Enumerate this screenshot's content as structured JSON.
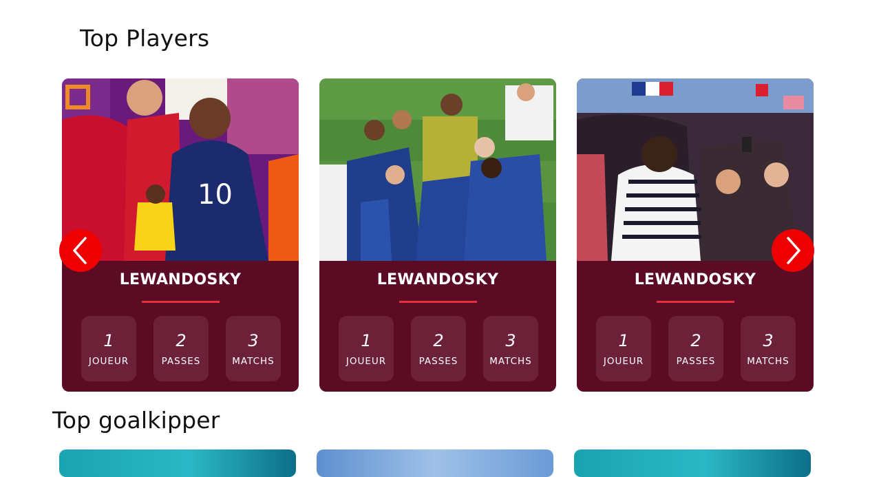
{
  "sections": {
    "top_players_title": "Top Players",
    "top_goalkeeper_title": "Top goalkipper"
  },
  "players": [
    {
      "name": "LEWANDOSKY",
      "stats": [
        {
          "value": "1",
          "label": "JOUEUR"
        },
        {
          "value": "2",
          "label": "PASSES"
        },
        {
          "value": "3",
          "label": "MATCHS"
        }
      ]
    },
    {
      "name": "LEWANDOSKY",
      "stats": [
        {
          "value": "1",
          "label": "JOUEUR"
        },
        {
          "value": "2",
          "label": "PASSES"
        },
        {
          "value": "3",
          "label": "MATCHS"
        }
      ]
    },
    {
      "name": "LEWANDOSKY",
      "stats": [
        {
          "value": "1",
          "label": "JOUEUR"
        },
        {
          "value": "2",
          "label": "PASSES"
        },
        {
          "value": "3",
          "label": "MATCHS"
        }
      ]
    }
  ],
  "navigation": {
    "prev_icon": "chevron-left-icon",
    "next_icon": "chevron-right-icon"
  },
  "colors": {
    "card_background": "#5c0b24",
    "stat_box": "#6d2138",
    "accent_red": "#e8303c",
    "nav_button": "#ee0000"
  }
}
